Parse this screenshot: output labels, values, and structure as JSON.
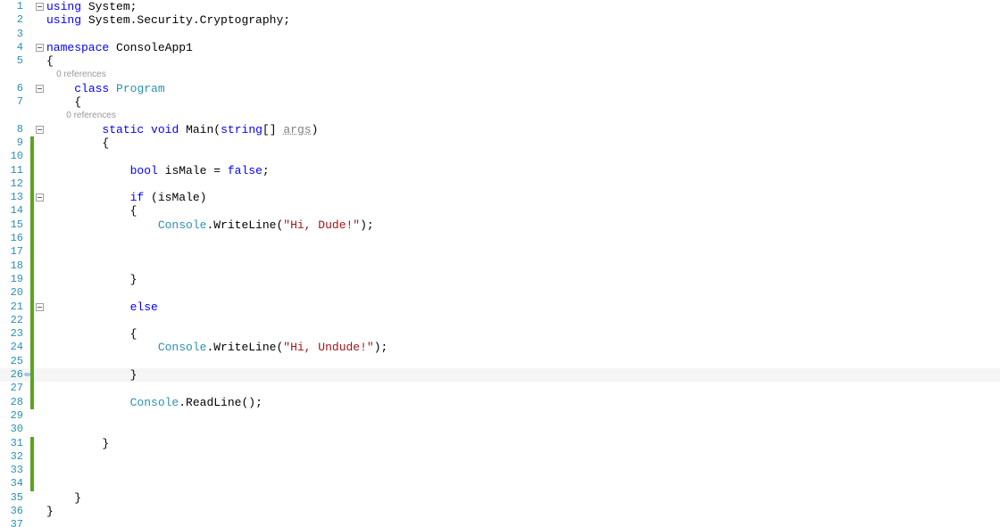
{
  "codelens": {
    "references": "0 references"
  },
  "tokens": {
    "using": "using",
    "system": "System",
    "semicolon": ";",
    "securityCrypto": "System.Security.Cryptography",
    "namespace": "namespace",
    "appname": "ConsoleApp1",
    "obrace": "{",
    "cbrace": "}",
    "class": "class",
    "program": "Program",
    "static": "static",
    "void": "void",
    "main": "Main",
    "oparen": "(",
    "cparen": ")",
    "stringArr": "string",
    "brackets": "[]",
    "args": "args",
    "bool": "bool",
    "isMale": "isMale",
    "eq": " = ",
    "false": "false",
    "if": "if",
    "console": "Console",
    "dot": ".",
    "writeLine": "WriteLine",
    "hiDude": "\"Hi, Dude!\"",
    "else": "else",
    "hiUndude": "\"Hi, Undude!\"",
    "readLine": "ReadLine",
    "empty": "()"
  },
  "lines": {
    "l1": "1",
    "l2": "2",
    "l3": "3",
    "l4": "4",
    "l5": "5",
    "l6": "6",
    "l7": "7",
    "l8": "8",
    "l9": "9",
    "l10": "10",
    "l11": "11",
    "l12": "12",
    "l13": "13",
    "l14": "14",
    "l15": "15",
    "l16": "16",
    "l17": "17",
    "l18": "18",
    "l19": "19",
    "l20": "20",
    "l21": "21",
    "l22": "22",
    "l23": "23",
    "l24": "24",
    "l25": "25",
    "l26": "26",
    "l27": "27",
    "l28": "28",
    "l29": "29",
    "l30": "30",
    "l31": "31",
    "l32": "32",
    "l33": "33",
    "l34": "34",
    "l35": "35",
    "l36": "36",
    "l37": "37"
  }
}
